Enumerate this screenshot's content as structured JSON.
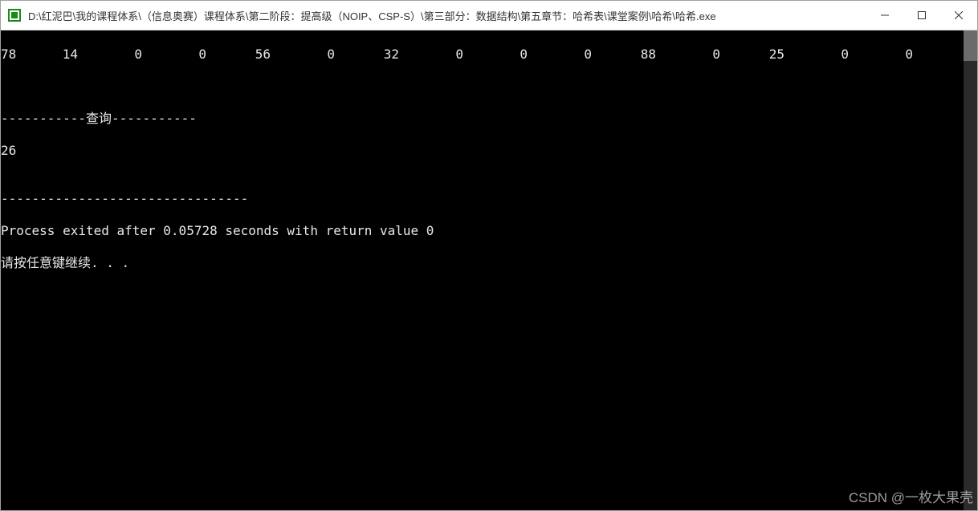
{
  "window": {
    "title": "D:\\红泥巴\\我的课程体系\\（信息奥赛）课程体系\\第二阶段：提高级（NOIP、CSP-S）\\第三部分：数据结构\\第五章节：哈希表\\课堂案例\\哈希\\哈希.exe"
  },
  "console": {
    "numbers": [
      "78",
      "14",
      "0",
      "0",
      "56",
      "0",
      "32",
      "0",
      "0",
      "0",
      "88",
      "0",
      "25",
      "0",
      "0"
    ],
    "blank1": "",
    "query_header": "-----------查询-----------",
    "query_result": "26",
    "blank2": "",
    "separator": "--------------------------------",
    "process_line": "Process exited after 0.05728 seconds with return value 0",
    "prompt_line": "请按任意键继续. . ."
  },
  "watermark": "CSDN @一枚大果壳"
}
